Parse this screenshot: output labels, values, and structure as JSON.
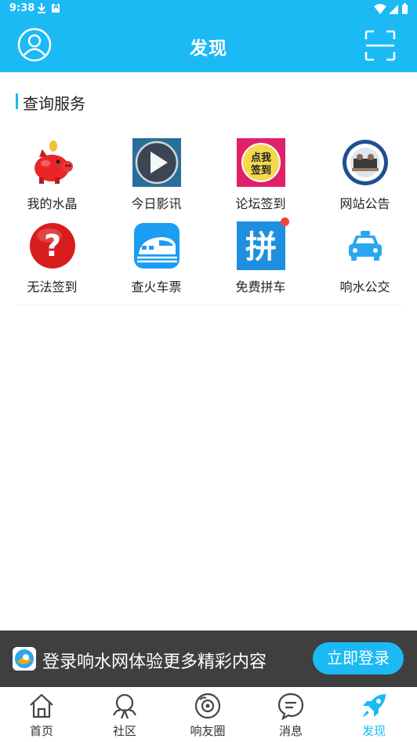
{
  "status": {
    "time": "9:38"
  },
  "header": {
    "title": "发现"
  },
  "section": {
    "title": "查询服务"
  },
  "services": [
    {
      "label": "我的水晶",
      "icon": "piggy-bank-icon"
    },
    {
      "label": "今日影讯",
      "icon": "play-video-icon"
    },
    {
      "label": "论坛签到",
      "icon": "checkin-badge-icon",
      "badge_text": [
        "点我",
        "签到"
      ]
    },
    {
      "label": "网站公告",
      "icon": "announcement-icon"
    },
    {
      "label": "无法签到",
      "icon": "question-mark-icon"
    },
    {
      "label": "查火车票",
      "icon": "train-icon"
    },
    {
      "label": "免费拼车",
      "icon": "carpool-icon",
      "icon_text": "拼",
      "has_badge": true
    },
    {
      "label": "响水公交",
      "icon": "bus-icon"
    }
  ],
  "banner": {
    "text": "登录响水网体验更多精彩内容",
    "button": "立即登录"
  },
  "tabs": [
    {
      "label": "首页",
      "icon": "home-icon",
      "active": false
    },
    {
      "label": "社区",
      "icon": "community-icon",
      "active": false
    },
    {
      "label": "响友圈",
      "icon": "circle-icon",
      "active": false
    },
    {
      "label": "消息",
      "icon": "message-icon",
      "active": false
    },
    {
      "label": "发现",
      "icon": "rocket-icon",
      "active": true
    }
  ],
  "colors": {
    "accent": "#1bbaf4",
    "banner_bg": "#3f3f3f",
    "badge": "#f0453a"
  }
}
